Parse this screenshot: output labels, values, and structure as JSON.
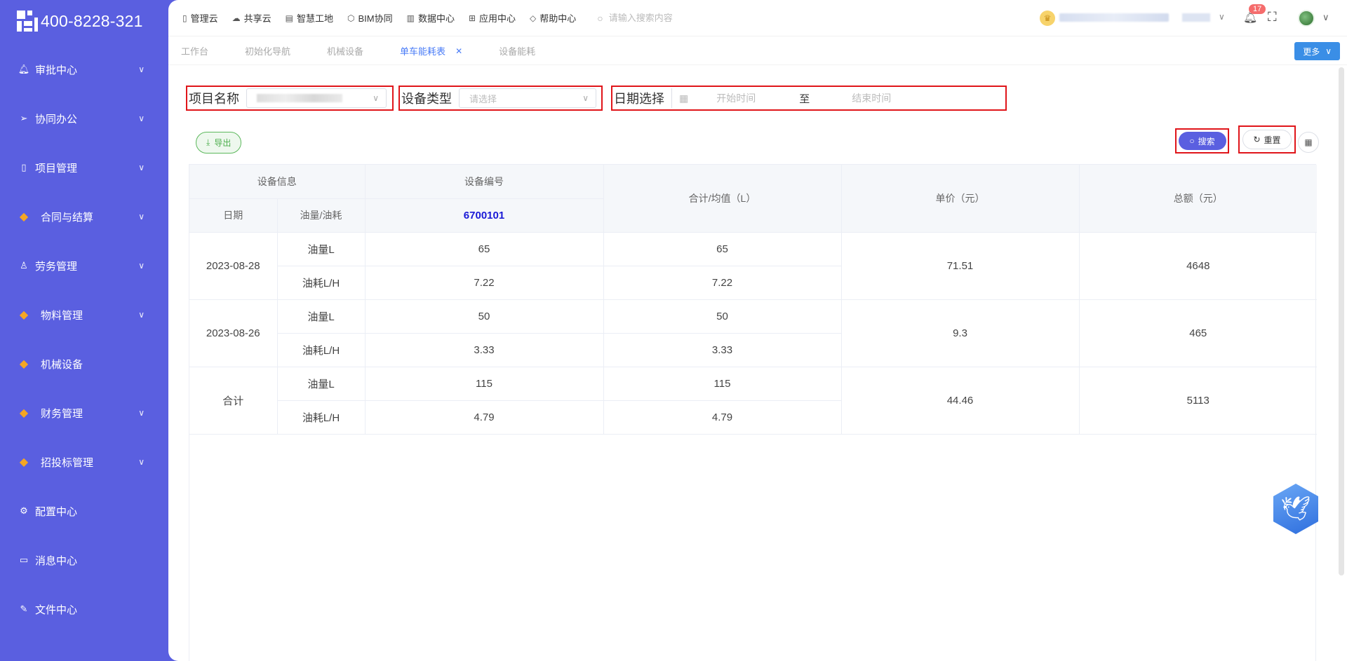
{
  "brand": {
    "phone": "400-8228-321"
  },
  "sidebar": {
    "items": [
      {
        "label": "审批中心",
        "icon": "bell-icon",
        "has_children": true
      },
      {
        "label": "协同办公",
        "icon": "send-icon",
        "has_children": true
      },
      {
        "label": "项目管理",
        "icon": "book-icon",
        "has_children": true
      },
      {
        "label": "合同与结算",
        "icon": "gem-icon",
        "has_children": true
      },
      {
        "label": "劳务管理",
        "icon": "user-icon",
        "has_children": true
      },
      {
        "label": "物料管理",
        "icon": "gem-icon",
        "has_children": true
      },
      {
        "label": "机械设备",
        "icon": "gem-icon",
        "has_children": false
      },
      {
        "label": "财务管理",
        "icon": "gem-icon",
        "has_children": true
      },
      {
        "label": "招投标管理",
        "icon": "gem-icon",
        "has_children": true
      },
      {
        "label": "配置中心",
        "icon": "gear-icon",
        "has_children": false
      },
      {
        "label": "消息中心",
        "icon": "message-icon",
        "has_children": false
      },
      {
        "label": "文件中心",
        "icon": "file-edit-icon",
        "has_children": false
      }
    ]
  },
  "topnav": {
    "links": [
      "管理云",
      "共享云",
      "智慧工地",
      "BIM协同",
      "数据中心",
      "应用中心",
      "帮助中心"
    ],
    "search_placeholder": "请输入搜索内容",
    "notification_count": "17"
  },
  "tabs": {
    "items": [
      "工作台",
      "初始化导航",
      "机械设备",
      "单车能耗表",
      "设备能耗"
    ],
    "active_index": 3,
    "more_label": "更多"
  },
  "filters": {
    "project_label": "项目名称",
    "device_type_label": "设备类型",
    "device_type_placeholder": "请选择",
    "date_label": "日期选择",
    "start_placeholder": "开始时间",
    "range_separator": "至",
    "end_placeholder": "结束时间"
  },
  "toolbar": {
    "export_label": "导出",
    "search_label": "搜索",
    "reset_label": "重置"
  },
  "table": {
    "group_header": "设备信息",
    "code_header": "设备编号",
    "date_header": "日期",
    "type_header": "油量/油耗",
    "device_code": "6700101",
    "total_header": "合计/均值（L）",
    "price_header": "单价（元）",
    "amount_header": "总额（元）",
    "groups": [
      {
        "date": "2023-08-28",
        "rows": [
          {
            "type": "油量L",
            "value": "65",
            "total": "65"
          },
          {
            "type": "油耗L/H",
            "value": "7.22",
            "total": "7.22"
          }
        ],
        "price": "71.51",
        "amount": "4648"
      },
      {
        "date": "2023-08-26",
        "rows": [
          {
            "type": "油量L",
            "value": "50",
            "total": "50"
          },
          {
            "type": "油耗L/H",
            "value": "3.33",
            "total": "3.33"
          }
        ],
        "price": "9.3",
        "amount": "465"
      },
      {
        "date": "合计",
        "rows": [
          {
            "type": "油量L",
            "value": "115",
            "total": "115"
          },
          {
            "type": "油耗L/H",
            "value": "4.79",
            "total": "4.79"
          }
        ],
        "price": "44.46",
        "amount": "5113"
      }
    ]
  },
  "colors": {
    "sidebar_bg": "#5a5fe0",
    "highlight_border": "#e0151a",
    "active_tab": "#4a7cf7",
    "device_code": "#1a1ad6"
  }
}
